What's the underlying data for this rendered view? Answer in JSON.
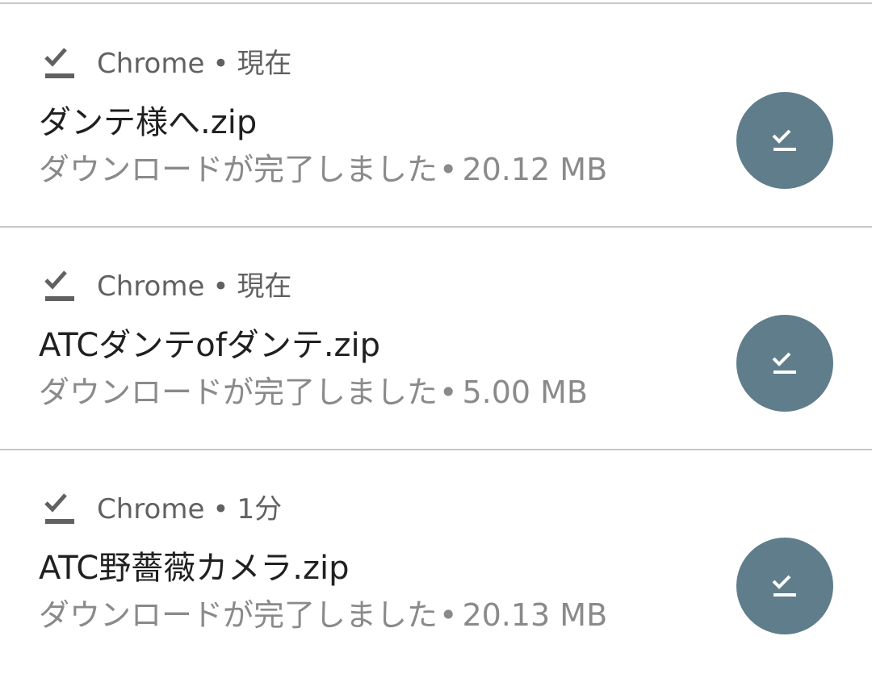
{
  "notifications": [
    {
      "icon": "download-done-icon",
      "app": "Chrome",
      "separator": "•",
      "time": "現在",
      "title": "ダンテ様へ.zip",
      "status": "ダウンロードが完了しました",
      "bullet": "•",
      "size": "20.12 MB",
      "action_icon": "download-done-icon",
      "action_color": "#607d8b"
    },
    {
      "icon": "download-done-icon",
      "app": "Chrome",
      "separator": "•",
      "time": "現在",
      "title": "ATCダンテofダンテ.zip",
      "status": "ダウンロードが完了しました",
      "bullet": "•",
      "size": "5.00 MB",
      "action_icon": "download-done-icon",
      "action_color": "#607d8b"
    },
    {
      "icon": "download-done-icon",
      "app": "Chrome",
      "separator": "•",
      "time": "1分",
      "title": "ATC野薔薇カメラ.zip",
      "status": "ダウンロードが完了しました",
      "bullet": "•",
      "size": "20.13 MB",
      "action_icon": "download-done-icon",
      "action_color": "#607d8b"
    }
  ]
}
